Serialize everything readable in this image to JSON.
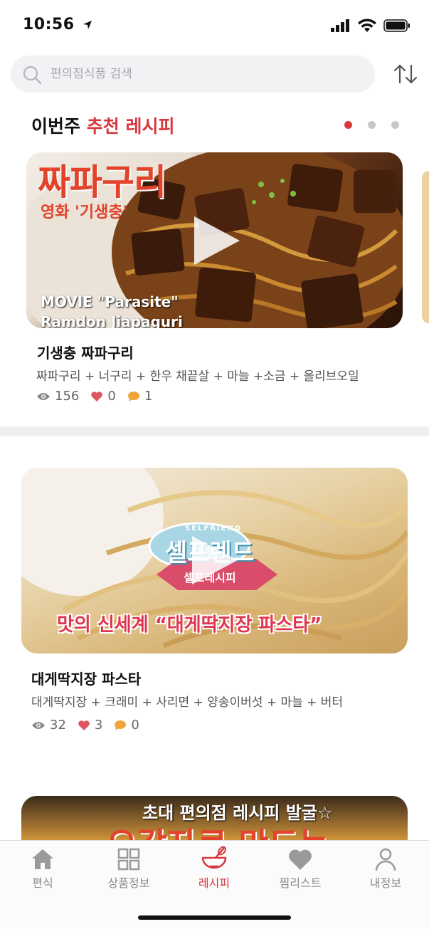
{
  "status_bar": {
    "time": "10:56"
  },
  "search": {
    "placeholder": "편의점식품 검색"
  },
  "section": {
    "title_prefix": "이번주",
    "title_accent": "추천 레시피"
  },
  "recipes": [
    {
      "title": "기생충 짜파구리",
      "ingredients": "짜파구리 + 너구리 + 한우 채끝살 + 마늘 +소금 + 올리브오일",
      "views": "156",
      "likes": "0",
      "comments": "1",
      "thumb_text": {
        "headline": "짜파구리",
        "sub": "영화 '기생충'",
        "caption1": "MOVIE \"Parasite\"",
        "caption2": "Ramdon Jiapaguri"
      }
    },
    {
      "title": "대게딱지장 파스타",
      "ingredients": "대게딱지장 + 크래미 + 사리면 + 양송이버섯 + 마늘 + 버터",
      "views": "32",
      "likes": "3",
      "comments": "0",
      "thumb_text": {
        "badge_top": "SELFRIEND",
        "badge": "셀프렌드",
        "badge_sub": "셀프레시피",
        "caption": "맛의 신세계 “대게딱지장 파스타”"
      }
    },
    {
      "thumb_text": {
        "caption_top": "초대 편의점 레시피 발굴☆",
        "caption_bottom": "오감자로 만드는"
      }
    }
  ],
  "tabs": [
    {
      "label": "편식",
      "icon": "home-icon"
    },
    {
      "label": "상품정보",
      "icon": "grid-icon"
    },
    {
      "label": "레시피",
      "icon": "recipe-bowl-icon"
    },
    {
      "label": "찜리스트",
      "icon": "heart-icon"
    },
    {
      "label": "내정보",
      "icon": "person-icon"
    }
  ],
  "colors": {
    "accent": "#d7383f",
    "text": "#111111",
    "muted": "#666666",
    "tab_inactive": "#8a8a8a",
    "comment": "#f0a43a"
  }
}
